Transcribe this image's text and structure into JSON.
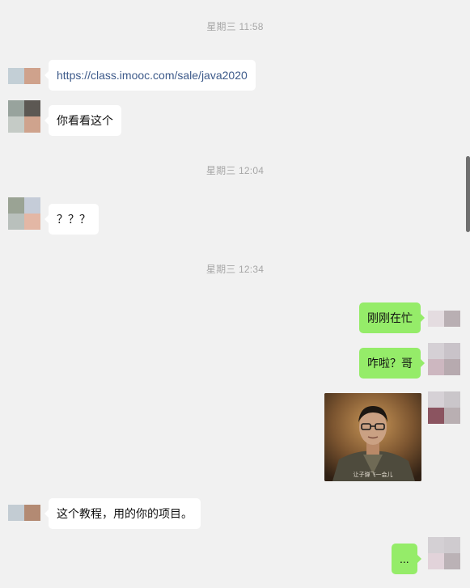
{
  "timestamps": [
    "星期三 11:58",
    "星期三 12:04",
    "星期三 12:34"
  ],
  "messages": {
    "m1": "https://class.imooc.com/sale/java2020",
    "m2": "你看看这个",
    "m3": "？？？",
    "m4": "刚刚在忙",
    "m5": "咋啦？哥",
    "m7": "这个教程，用的你的项目。",
    "m8": "..."
  },
  "image_message": {
    "subtitle": "让子弹飞一会儿",
    "description": "video still of a man with glasses"
  },
  "colors": {
    "background": "#f1f1f1",
    "incoming_bubble": "#ffffff",
    "outgoing_bubble": "#95ec69",
    "timestamp_text": "#a7a7a7",
    "link_text": "#3d5a8a"
  },
  "icons": {
    "avatar": "pixelated-avatar-icon"
  }
}
